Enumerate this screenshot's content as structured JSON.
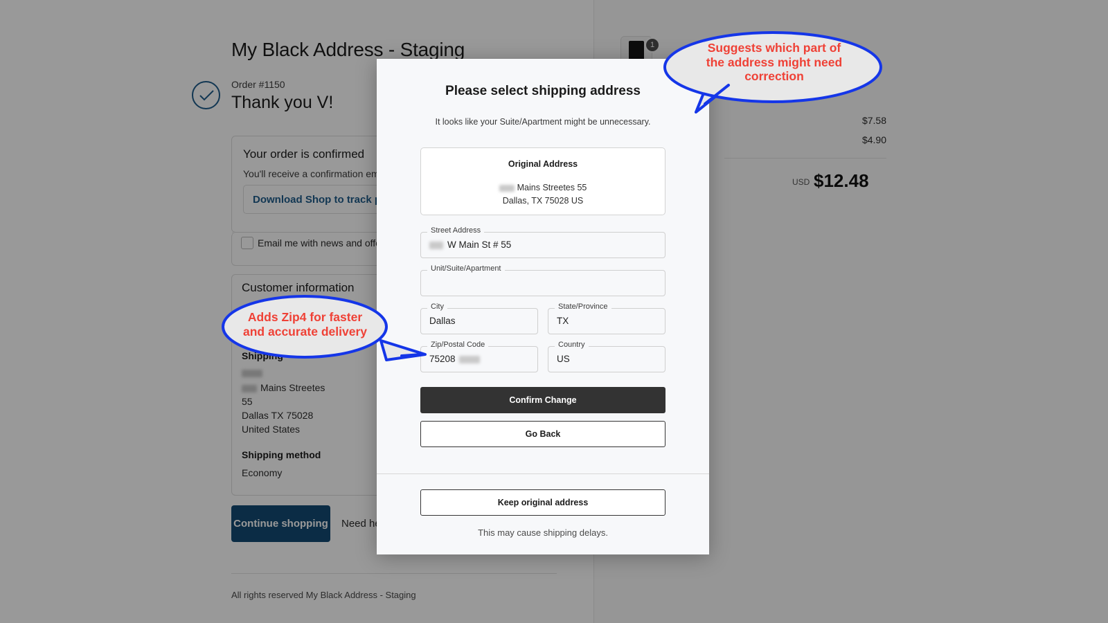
{
  "page": {
    "shop_title": "My Black Address - Staging",
    "order_number": "Order #1150",
    "thank_you": "Thank you V!",
    "confirmed_heading": "Your order is confirmed",
    "confirmed_sub": "You'll receive a confirmation email wi",
    "download_link": "Download Shop to track package",
    "email_optin": "Email me with news and offers",
    "customer_info_heading": "Customer information",
    "shipping_heading": "Shipping",
    "ship_addr_line1": "Mains Streetes",
    "ship_addr_line2": "55",
    "ship_addr_line3": "Dallas TX 75028",
    "ship_addr_line4": "United States",
    "shipping_method_heading": "Shipping method",
    "shipping_method_value": "Economy",
    "continue_shopping": "Continue shopping",
    "need_help": "Need help",
    "footer": "All rights reserved My Black Address - Staging"
  },
  "cart": {
    "qty_badge": "1",
    "price_1": "$7.58",
    "price_2": "$4.90",
    "currency_label": "USD",
    "total": "$12.48"
  },
  "modal": {
    "title": "Please select shipping address",
    "subtitle": "It looks like your Suite/Apartment might be unnecessary.",
    "original_address": {
      "heading": "Original Address",
      "line1": "Mains Streetes 55",
      "line2": "Dallas, TX 75028 US"
    },
    "fields": [
      {
        "label": "Street Address",
        "value": "W Main St # 55",
        "redacted_prefix": true
      },
      {
        "label": "Unit/Suite/Apartment",
        "value": "",
        "redacted_prefix": false
      },
      {
        "label": "City",
        "value": "Dallas",
        "redacted_prefix": false
      },
      {
        "label": "State/Province",
        "value": "TX",
        "redacted_prefix": false
      },
      {
        "label": "Zip/Postal Code",
        "value": "75208",
        "redacted_suffix": true
      },
      {
        "label": "Country",
        "value": "US",
        "redacted_prefix": false
      }
    ],
    "confirm_button": "Confirm Change",
    "go_back_button": "Go Back",
    "keep_original_button": "Keep original address",
    "footer_note": "This may cause shipping delays."
  },
  "annotations": [
    {
      "id": "suggest-bubble",
      "lines": [
        "Suggests which part of",
        "the address might need",
        "correction"
      ],
      "color": "#ef4136",
      "border_color": "#1536e8"
    },
    {
      "id": "zip4-bubble",
      "lines": [
        "Adds Zip4 for faster",
        "and accurate delivery"
      ],
      "color": "#ef4136",
      "border_color": "#1536e8"
    }
  ],
  "colors": {
    "accent_blue": "#134a73",
    "link_blue": "#1f5c8b",
    "annotation_red": "#ef4136",
    "annotation_border": "#1536e8",
    "button_dark": "#333333"
  }
}
